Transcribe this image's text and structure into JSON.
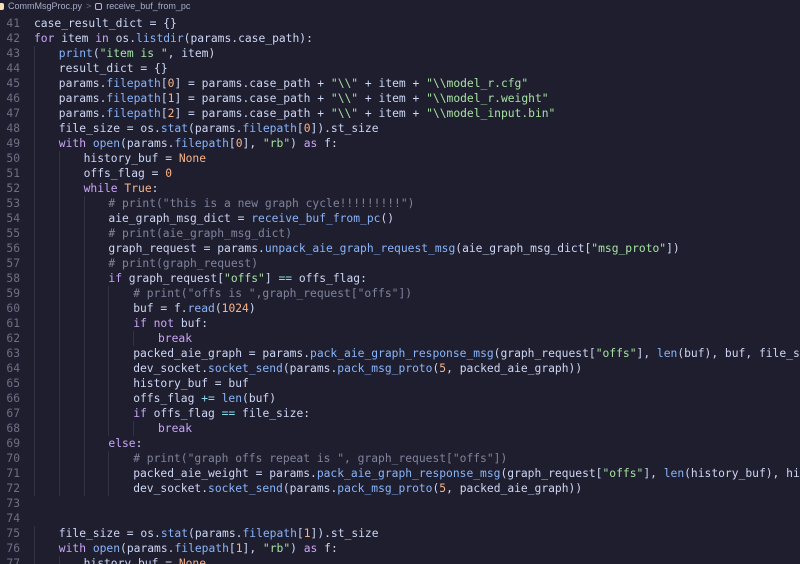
{
  "breadcrumb": {
    "file": "CommMsgProc.py",
    "separator": ">",
    "symbol": "receive_buf_from_pc"
  },
  "editor": {
    "lines": [
      {
        "n": "41",
        "indent": 0,
        "tokens": [
          [
            "case_result_dict = {}",
            ""
          ]
        ]
      },
      {
        "n": "42",
        "indent": 0,
        "tokens": [
          [
            "for",
            "kw"
          ],
          [
            " item ",
            ""
          ],
          [
            "in",
            "kw"
          ],
          [
            " os.",
            ""
          ],
          [
            "listdir",
            "fn"
          ],
          [
            "(params.case_path):",
            ""
          ]
        ]
      },
      {
        "n": "43",
        "indent": 1,
        "tokens": [
          [
            "print",
            "fn"
          ],
          [
            "(",
            ""
          ],
          [
            "\"item is \"",
            "str"
          ],
          [
            ", item)",
            ""
          ]
        ]
      },
      {
        "n": "44",
        "indent": 1,
        "tokens": [
          [
            "result_dict = {}",
            ""
          ]
        ]
      },
      {
        "n": "45",
        "indent": 1,
        "tokens": [
          [
            "params.",
            ""
          ],
          [
            "filepath",
            "fn"
          ],
          [
            "[",
            ""
          ],
          [
            "0",
            "num"
          ],
          [
            "] = params.case_path + ",
            ""
          ],
          [
            "\"\\\\\"",
            "str"
          ],
          [
            " + item + ",
            ""
          ],
          [
            "\"\\\\model_r.cfg\"",
            "str"
          ]
        ]
      },
      {
        "n": "46",
        "indent": 1,
        "tokens": [
          [
            "params.",
            ""
          ],
          [
            "filepath",
            "fn"
          ],
          [
            "[",
            ""
          ],
          [
            "1",
            "num"
          ],
          [
            "] = params.case_path + ",
            ""
          ],
          [
            "\"\\\\\"",
            "str"
          ],
          [
            " + item + ",
            ""
          ],
          [
            "\"\\\\model_r.weight\"",
            "str"
          ]
        ]
      },
      {
        "n": "47",
        "indent": 1,
        "tokens": [
          [
            "params.",
            ""
          ],
          [
            "filepath",
            "fn"
          ],
          [
            "[",
            ""
          ],
          [
            "2",
            "num"
          ],
          [
            "] = params.case_path + ",
            ""
          ],
          [
            "\"\\\\\"",
            "str"
          ],
          [
            " + item + ",
            ""
          ],
          [
            "\"\\\\model_input.bin\"",
            "str"
          ]
        ]
      },
      {
        "n": "48",
        "indent": 1,
        "tokens": [
          [
            "file_size = os.",
            ""
          ],
          [
            "stat",
            "fn"
          ],
          [
            "(params.",
            ""
          ],
          [
            "filepath",
            "fn"
          ],
          [
            "[",
            ""
          ],
          [
            "0",
            "num"
          ],
          [
            "]).st_size",
            ""
          ]
        ]
      },
      {
        "n": "49",
        "indent": 1,
        "tokens": [
          [
            "with",
            "kw"
          ],
          [
            " ",
            ""
          ],
          [
            "open",
            "fn"
          ],
          [
            "(params.",
            ""
          ],
          [
            "filepath",
            "fn"
          ],
          [
            "[",
            ""
          ],
          [
            "0",
            "num"
          ],
          [
            "], ",
            ""
          ],
          [
            "\"rb\"",
            "str"
          ],
          [
            ") ",
            ""
          ],
          [
            "as",
            "kw"
          ],
          [
            " f:",
            ""
          ]
        ]
      },
      {
        "n": "50",
        "indent": 2,
        "tokens": [
          [
            "history_buf = ",
            ""
          ],
          [
            "None",
            "bi"
          ]
        ]
      },
      {
        "n": "51",
        "indent": 2,
        "tokens": [
          [
            "offs_flag = ",
            ""
          ],
          [
            "0",
            "num"
          ]
        ]
      },
      {
        "n": "52",
        "indent": 2,
        "tokens": [
          [
            "while",
            "kw"
          ],
          [
            " ",
            ""
          ],
          [
            "True",
            "bi"
          ],
          [
            ":",
            ""
          ]
        ]
      },
      {
        "n": "53",
        "indent": 3,
        "tokens": [
          [
            "# print(\"this is a new graph cycle!!!!!!!!!\")",
            "cm"
          ]
        ]
      },
      {
        "n": "54",
        "indent": 3,
        "tokens": [
          [
            "aie_graph_msg_dict = ",
            ""
          ],
          [
            "receive_buf_from_pc",
            "fn"
          ],
          [
            "()",
            ""
          ]
        ]
      },
      {
        "n": "55",
        "indent": 3,
        "tokens": [
          [
            "# print(aie_graph_msg_dict)",
            "cm"
          ]
        ]
      },
      {
        "n": "56",
        "indent": 3,
        "tokens": [
          [
            "graph_request = params.",
            ""
          ],
          [
            "unpack_aie_graph_request_msg",
            "fn"
          ],
          [
            "(aie_graph_msg_dict[",
            ""
          ],
          [
            "\"msg_proto\"",
            "str"
          ],
          [
            "])",
            ""
          ]
        ]
      },
      {
        "n": "57",
        "indent": 3,
        "tokens": [
          [
            "# print(graph_request)",
            "cm"
          ]
        ]
      },
      {
        "n": "58",
        "indent": 3,
        "tokens": [
          [
            "if",
            "kw"
          ],
          [
            " graph_request[",
            ""
          ],
          [
            "\"offs\"",
            "str"
          ],
          [
            "] ",
            ""
          ],
          [
            "==",
            "op"
          ],
          [
            " offs_flag:",
            ""
          ]
        ]
      },
      {
        "n": "59",
        "indent": 4,
        "tokens": [
          [
            "# print(\"offs is \",graph_request[\"offs\"])",
            "cm"
          ]
        ]
      },
      {
        "n": "60",
        "indent": 4,
        "tokens": [
          [
            "buf = f.",
            ""
          ],
          [
            "read",
            "fn"
          ],
          [
            "(",
            ""
          ],
          [
            "1024",
            "num"
          ],
          [
            ")",
            ""
          ]
        ]
      },
      {
        "n": "61",
        "indent": 4,
        "tokens": [
          [
            "if",
            "kw"
          ],
          [
            " ",
            ""
          ],
          [
            "not",
            "kw"
          ],
          [
            " buf:",
            ""
          ]
        ]
      },
      {
        "n": "62",
        "indent": 5,
        "tokens": [
          [
            "break",
            "kw"
          ]
        ]
      },
      {
        "n": "63",
        "indent": 4,
        "tokens": [
          [
            "packed_aie_graph = params.",
            ""
          ],
          [
            "pack_aie_graph_response_msg",
            "fn"
          ],
          [
            "(graph_request[",
            ""
          ],
          [
            "\"offs\"",
            "str"
          ],
          [
            "], ",
            ""
          ],
          [
            "len",
            "fn"
          ],
          [
            "(buf), buf, file_size)",
            ""
          ]
        ]
      },
      {
        "n": "64",
        "indent": 4,
        "tokens": [
          [
            "dev_socket.",
            ""
          ],
          [
            "socket_send",
            "fn"
          ],
          [
            "(params.",
            ""
          ],
          [
            "pack_msg_proto",
            "fn"
          ],
          [
            "(",
            ""
          ],
          [
            "5",
            "num"
          ],
          [
            ", packed_aie_graph))",
            ""
          ]
        ]
      },
      {
        "n": "65",
        "indent": 4,
        "tokens": [
          [
            "history_buf = buf",
            ""
          ]
        ]
      },
      {
        "n": "66",
        "indent": 4,
        "tokens": [
          [
            "offs_flag ",
            ""
          ],
          [
            "+=",
            "op"
          ],
          [
            " ",
            ""
          ],
          [
            "len",
            "fn"
          ],
          [
            "(buf)",
            ""
          ]
        ]
      },
      {
        "n": "67",
        "indent": 4,
        "tokens": [
          [
            "if",
            "kw"
          ],
          [
            " offs_flag ",
            ""
          ],
          [
            "==",
            "op"
          ],
          [
            " file_size:",
            ""
          ]
        ]
      },
      {
        "n": "68",
        "indent": 5,
        "tokens": [
          [
            "break",
            "kw"
          ]
        ]
      },
      {
        "n": "69",
        "indent": 3,
        "tokens": [
          [
            "else",
            "kw"
          ],
          [
            ":",
            ""
          ]
        ]
      },
      {
        "n": "70",
        "indent": 4,
        "tokens": [
          [
            "# print(\"graph offs repeat is \", graph_request[\"offs\"])",
            "cm"
          ]
        ]
      },
      {
        "n": "71",
        "indent": 4,
        "tokens": [
          [
            "packed_aie_weight = params.",
            ""
          ],
          [
            "pack_aie_graph_response_msg",
            "fn"
          ],
          [
            "(graph_request[",
            ""
          ],
          [
            "\"offs\"",
            "str"
          ],
          [
            "], ",
            ""
          ],
          [
            "len",
            "fn"
          ],
          [
            "(history_buf), history_buf,",
            ""
          ]
        ]
      },
      {
        "n": "72",
        "indent": 4,
        "tokens": [
          [
            "dev_socket.",
            ""
          ],
          [
            "socket_send",
            "fn"
          ],
          [
            "(params.",
            ""
          ],
          [
            "pack_msg_proto",
            "fn"
          ],
          [
            "(",
            ""
          ],
          [
            "5",
            "num"
          ],
          [
            ", packed_aie_graph))",
            ""
          ]
        ]
      },
      {
        "n": "73",
        "indent": 0,
        "tokens": []
      },
      {
        "n": "74",
        "indent": 0,
        "tokens": []
      },
      {
        "n": "75",
        "indent": 1,
        "tokens": [
          [
            "file_size = os.",
            ""
          ],
          [
            "stat",
            "fn"
          ],
          [
            "(params.",
            ""
          ],
          [
            "filepath",
            "fn"
          ],
          [
            "[",
            ""
          ],
          [
            "1",
            "num"
          ],
          [
            "]).st_size",
            ""
          ]
        ]
      },
      {
        "n": "76",
        "indent": 1,
        "tokens": [
          [
            "with",
            "kw"
          ],
          [
            " ",
            ""
          ],
          [
            "open",
            "fn"
          ],
          [
            "(params.",
            ""
          ],
          [
            "filepath",
            "fn"
          ],
          [
            "[",
            ""
          ],
          [
            "1",
            "num"
          ],
          [
            "], ",
            ""
          ],
          [
            "\"rb\"",
            "str"
          ],
          [
            ") ",
            ""
          ],
          [
            "as",
            "kw"
          ],
          [
            " f:",
            ""
          ]
        ]
      },
      {
        "n": "77",
        "indent": 2,
        "tokens": [
          [
            "history_buf = ",
            ""
          ],
          [
            "None",
            "bi"
          ]
        ]
      }
    ]
  }
}
